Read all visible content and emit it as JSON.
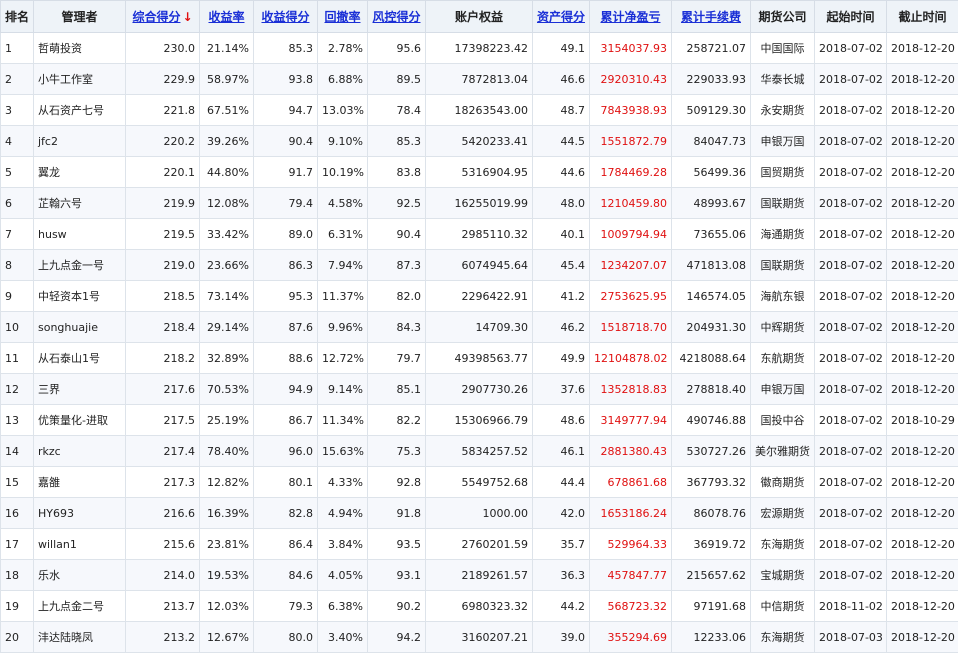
{
  "headers": [
    {
      "key": "rank",
      "label": "排名",
      "link": false
    },
    {
      "key": "manager",
      "label": "管理者",
      "link": false
    },
    {
      "key": "score",
      "label": "综合得分",
      "link": true,
      "sorted": true,
      "sort_icon": "arrow-down-icon",
      "sort_glyph": "↓"
    },
    {
      "key": "return_rate",
      "label": "收益率",
      "link": true
    },
    {
      "key": "return_score",
      "label": "收益得分",
      "link": true
    },
    {
      "key": "drawdown",
      "label": "回撤率",
      "link": true
    },
    {
      "key": "risk_score",
      "label": "风控得分",
      "link": true
    },
    {
      "key": "equity",
      "label": "账户权益",
      "link": false
    },
    {
      "key": "asset_score",
      "label": "资产得分",
      "link": true
    },
    {
      "key": "net_profit",
      "label": "累计净盈亏",
      "link": true
    },
    {
      "key": "fees",
      "label": "累计手续费",
      "link": true
    },
    {
      "key": "broker",
      "label": "期货公司",
      "link": false
    },
    {
      "key": "start",
      "label": "起始时间",
      "link": false
    },
    {
      "key": "end",
      "label": "截止时间",
      "link": false
    }
  ],
  "accent_link": "#1a2fd6",
  "accent_red": "#e01010",
  "rows": [
    {
      "rank": "1",
      "manager": "哲萌投资",
      "score": "230.0",
      "return_rate": "21.14%",
      "return_score": "85.3",
      "drawdown": "2.78%",
      "risk_score": "95.6",
      "equity": "17398223.42",
      "asset_score": "49.1",
      "net_profit": "3154037.93",
      "fees": "258721.07",
      "broker": "中国国际",
      "start": "2018-07-02",
      "end": "2018-12-20"
    },
    {
      "rank": "2",
      "manager": "小牛工作室",
      "score": "229.9",
      "return_rate": "58.97%",
      "return_score": "93.8",
      "drawdown": "6.88%",
      "risk_score": "89.5",
      "equity": "7872813.04",
      "asset_score": "46.6",
      "net_profit": "2920310.43",
      "fees": "229033.93",
      "broker": "华泰长城",
      "start": "2018-07-02",
      "end": "2018-12-20"
    },
    {
      "rank": "3",
      "manager": "从石资产七号",
      "score": "221.8",
      "return_rate": "67.51%",
      "return_score": "94.7",
      "drawdown": "13.03%",
      "risk_score": "78.4",
      "equity": "18263543.00",
      "asset_score": "48.7",
      "net_profit": "7843938.93",
      "fees": "509129.30",
      "broker": "永安期货",
      "start": "2018-07-02",
      "end": "2018-12-20"
    },
    {
      "rank": "4",
      "manager": "jfc2",
      "score": "220.2",
      "return_rate": "39.26%",
      "return_score": "90.4",
      "drawdown": "9.10%",
      "risk_score": "85.3",
      "equity": "5420233.41",
      "asset_score": "44.5",
      "net_profit": "1551872.79",
      "fees": "84047.73",
      "broker": "申银万国",
      "start": "2018-07-02",
      "end": "2018-12-20"
    },
    {
      "rank": "5",
      "manager": "翼龙",
      "score": "220.1",
      "return_rate": "44.80%",
      "return_score": "91.7",
      "drawdown": "10.19%",
      "risk_score": "83.8",
      "equity": "5316904.95",
      "asset_score": "44.6",
      "net_profit": "1784469.28",
      "fees": "56499.36",
      "broker": "国贸期货",
      "start": "2018-07-02",
      "end": "2018-12-20"
    },
    {
      "rank": "6",
      "manager": "芷翰六号",
      "score": "219.9",
      "return_rate": "12.08%",
      "return_score": "79.4",
      "drawdown": "4.58%",
      "risk_score": "92.5",
      "equity": "16255019.99",
      "asset_score": "48.0",
      "net_profit": "1210459.80",
      "fees": "48993.67",
      "broker": "国联期货",
      "start": "2018-07-02",
      "end": "2018-12-20"
    },
    {
      "rank": "7",
      "manager": "husw",
      "score": "219.5",
      "return_rate": "33.42%",
      "return_score": "89.0",
      "drawdown": "6.31%",
      "risk_score": "90.4",
      "equity": "2985110.32",
      "asset_score": "40.1",
      "net_profit": "1009794.94",
      "fees": "73655.06",
      "broker": "海通期货",
      "start": "2018-07-02",
      "end": "2018-12-20"
    },
    {
      "rank": "8",
      "manager": "上九点金一号",
      "score": "219.0",
      "return_rate": "23.66%",
      "return_score": "86.3",
      "drawdown": "7.94%",
      "risk_score": "87.3",
      "equity": "6074945.64",
      "asset_score": "45.4",
      "net_profit": "1234207.07",
      "fees": "471813.08",
      "broker": "国联期货",
      "start": "2018-07-02",
      "end": "2018-12-20"
    },
    {
      "rank": "9",
      "manager": "中轻资本1号",
      "score": "218.5",
      "return_rate": "73.14%",
      "return_score": "95.3",
      "drawdown": "11.37%",
      "risk_score": "82.0",
      "equity": "2296422.91",
      "asset_score": "41.2",
      "net_profit": "2753625.95",
      "fees": "146574.05",
      "broker": "海航东银",
      "start": "2018-07-02",
      "end": "2018-12-20"
    },
    {
      "rank": "10",
      "manager": "songhuajie",
      "score": "218.4",
      "return_rate": "29.14%",
      "return_score": "87.6",
      "drawdown": "9.96%",
      "risk_score": "84.3",
      "equity": "14709.30",
      "asset_score": "46.2",
      "net_profit": "1518718.70",
      "fees": "204931.30",
      "broker": "中辉期货",
      "start": "2018-07-02",
      "end": "2018-12-20"
    },
    {
      "rank": "11",
      "manager": "从石泰山1号",
      "score": "218.2",
      "return_rate": "32.89%",
      "return_score": "88.6",
      "drawdown": "12.72%",
      "risk_score": "79.7",
      "equity": "49398563.77",
      "asset_score": "49.9",
      "net_profit": "12104878.02",
      "fees": "4218088.64",
      "broker": "东航期货",
      "start": "2018-07-02",
      "end": "2018-12-20"
    },
    {
      "rank": "12",
      "manager": "三界",
      "score": "217.6",
      "return_rate": "70.53%",
      "return_score": "94.9",
      "drawdown": "9.14%",
      "risk_score": "85.1",
      "equity": "2907730.26",
      "asset_score": "37.6",
      "net_profit": "1352818.83",
      "fees": "278818.40",
      "broker": "申银万国",
      "start": "2018-07-02",
      "end": "2018-12-20"
    },
    {
      "rank": "13",
      "manager": "优策量化-进取",
      "score": "217.5",
      "return_rate": "25.19%",
      "return_score": "86.7",
      "drawdown": "11.34%",
      "risk_score": "82.2",
      "equity": "15306966.79",
      "asset_score": "48.6",
      "net_profit": "3149777.94",
      "fees": "490746.88",
      "broker": "国投中谷",
      "start": "2018-07-02",
      "end": "2018-10-29"
    },
    {
      "rank": "14",
      "manager": "rkzc",
      "score": "217.4",
      "return_rate": "78.40%",
      "return_score": "96.0",
      "drawdown": "15.63%",
      "risk_score": "75.3",
      "equity": "5834257.52",
      "asset_score": "46.1",
      "net_profit": "2881380.43",
      "fees": "530727.26",
      "broker": "美尔雅期货",
      "start": "2018-07-02",
      "end": "2018-12-20"
    },
    {
      "rank": "15",
      "manager": "嘉雒",
      "score": "217.3",
      "return_rate": "12.82%",
      "return_score": "80.1",
      "drawdown": "4.33%",
      "risk_score": "92.8",
      "equity": "5549752.68",
      "asset_score": "44.4",
      "net_profit": "678861.68",
      "fees": "367793.32",
      "broker": "徽商期货",
      "start": "2018-07-02",
      "end": "2018-12-20"
    },
    {
      "rank": "16",
      "manager": "HY693",
      "score": "216.6",
      "return_rate": "16.39%",
      "return_score": "82.8",
      "drawdown": "4.94%",
      "risk_score": "91.8",
      "equity": "1000.00",
      "asset_score": "42.0",
      "net_profit": "1653186.24",
      "fees": "86078.76",
      "broker": "宏源期货",
      "start": "2018-07-02",
      "end": "2018-12-20"
    },
    {
      "rank": "17",
      "manager": "willan1",
      "score": "215.6",
      "return_rate": "23.81%",
      "return_score": "86.4",
      "drawdown": "3.84%",
      "risk_score": "93.5",
      "equity": "2760201.59",
      "asset_score": "35.7",
      "net_profit": "529964.33",
      "fees": "36919.72",
      "broker": "东海期货",
      "start": "2018-07-02",
      "end": "2018-12-20"
    },
    {
      "rank": "18",
      "manager": "乐水",
      "score": "214.0",
      "return_rate": "19.53%",
      "return_score": "84.6",
      "drawdown": "4.05%",
      "risk_score": "93.1",
      "equity": "2189261.57",
      "asset_score": "36.3",
      "net_profit": "457847.77",
      "fees": "215657.62",
      "broker": "宝城期货",
      "start": "2018-07-02",
      "end": "2018-12-20"
    },
    {
      "rank": "19",
      "manager": "上九点金二号",
      "score": "213.7",
      "return_rate": "12.03%",
      "return_score": "79.3",
      "drawdown": "6.38%",
      "risk_score": "90.2",
      "equity": "6980323.32",
      "asset_score": "44.2",
      "net_profit": "568723.32",
      "fees": "97191.68",
      "broker": "中信期货",
      "start": "2018-11-02",
      "end": "2018-12-20"
    },
    {
      "rank": "20",
      "manager": "沣达陆晓凤",
      "score": "213.2",
      "return_rate": "12.67%",
      "return_score": "80.0",
      "drawdown": "3.40%",
      "risk_score": "94.2",
      "equity": "3160207.21",
      "asset_score": "39.0",
      "net_profit": "355294.69",
      "fees": "12233.06",
      "broker": "东海期货",
      "start": "2018-07-03",
      "end": "2018-12-20"
    }
  ]
}
